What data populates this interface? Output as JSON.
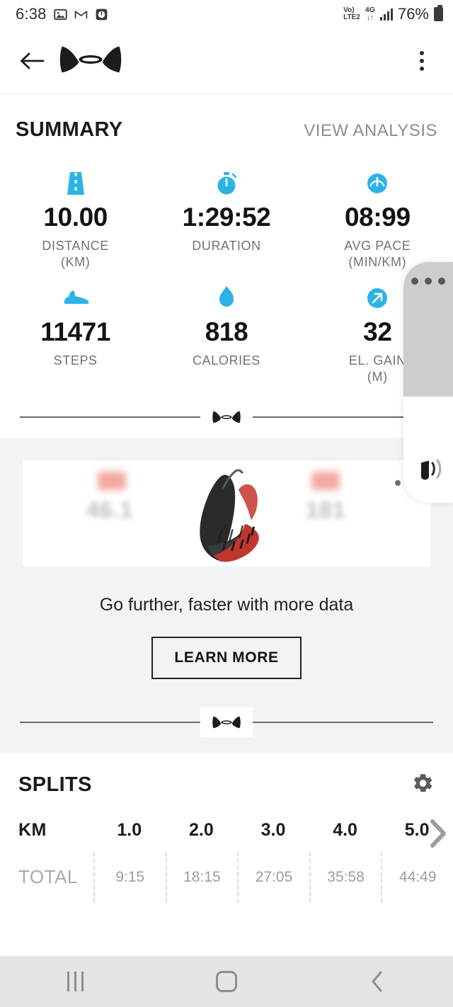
{
  "status_bar": {
    "clock": "6:38",
    "left_icons": [
      "photos-icon",
      "gmail-icon",
      "clock-icon"
    ],
    "volte_line1": "Vo)",
    "volte_line2": "LTE2",
    "network_line1": "4G",
    "network_line2": "↓↑",
    "battery_percent": "76%",
    "signal_bars": 4
  },
  "app_bar": {
    "back_icon": "back-arrow-icon",
    "brand_logo": "under-armour-logo",
    "overflow_icon": "kebab-menu-icon"
  },
  "summary": {
    "title": "SUMMARY",
    "action_label": "VIEW ANALYSIS",
    "accent_color": "#2bb3e8",
    "metrics": [
      {
        "icon": "road-icon",
        "value": "10.00",
        "label": "DISTANCE\n(KM)"
      },
      {
        "icon": "stopwatch-icon",
        "value": "1:29:52",
        "label": "DURATION"
      },
      {
        "icon": "speedometer-icon",
        "value": "08:99",
        "label": "AVG PACE\n(MIN/KM)"
      },
      {
        "icon": "shoe-icon",
        "value": "11471",
        "label": "STEPS"
      },
      {
        "icon": "flame-icon",
        "value": "818",
        "label": "CALORIES"
      },
      {
        "icon": "elevation-arrow-icon",
        "value": "32",
        "label": "EL. GAIN\n(M)"
      }
    ]
  },
  "divider": {
    "mark": "under-armour-logo"
  },
  "ad": {
    "headline": "Go further, faster with more data",
    "button_label": "LEARN MORE",
    "overflow_icon": "ad-options-icon",
    "media": {
      "product": "running-shoe-image",
      "blurred_left_value": "46.1",
      "blurred_right_value": "181"
    }
  },
  "splits": {
    "title": "SPLITS",
    "settings_icon": "gear-icon",
    "more_icon": "chevron-right-icon",
    "row_headers": [
      "KM",
      "TOTAL"
    ],
    "km_values": [
      "1.0",
      "2.0",
      "3.0",
      "4.0",
      "5.0"
    ],
    "total_values": [
      "9:15",
      "18:15",
      "27:05",
      "35:58",
      "44:49"
    ]
  },
  "edge_panel": {
    "handle_icon": "drag-dots-icon",
    "music_icon": "music-note-icon"
  },
  "nav_bar": {
    "recents_icon": "recents-icon",
    "home_icon": "home-icon",
    "back_icon": "back-icon"
  }
}
